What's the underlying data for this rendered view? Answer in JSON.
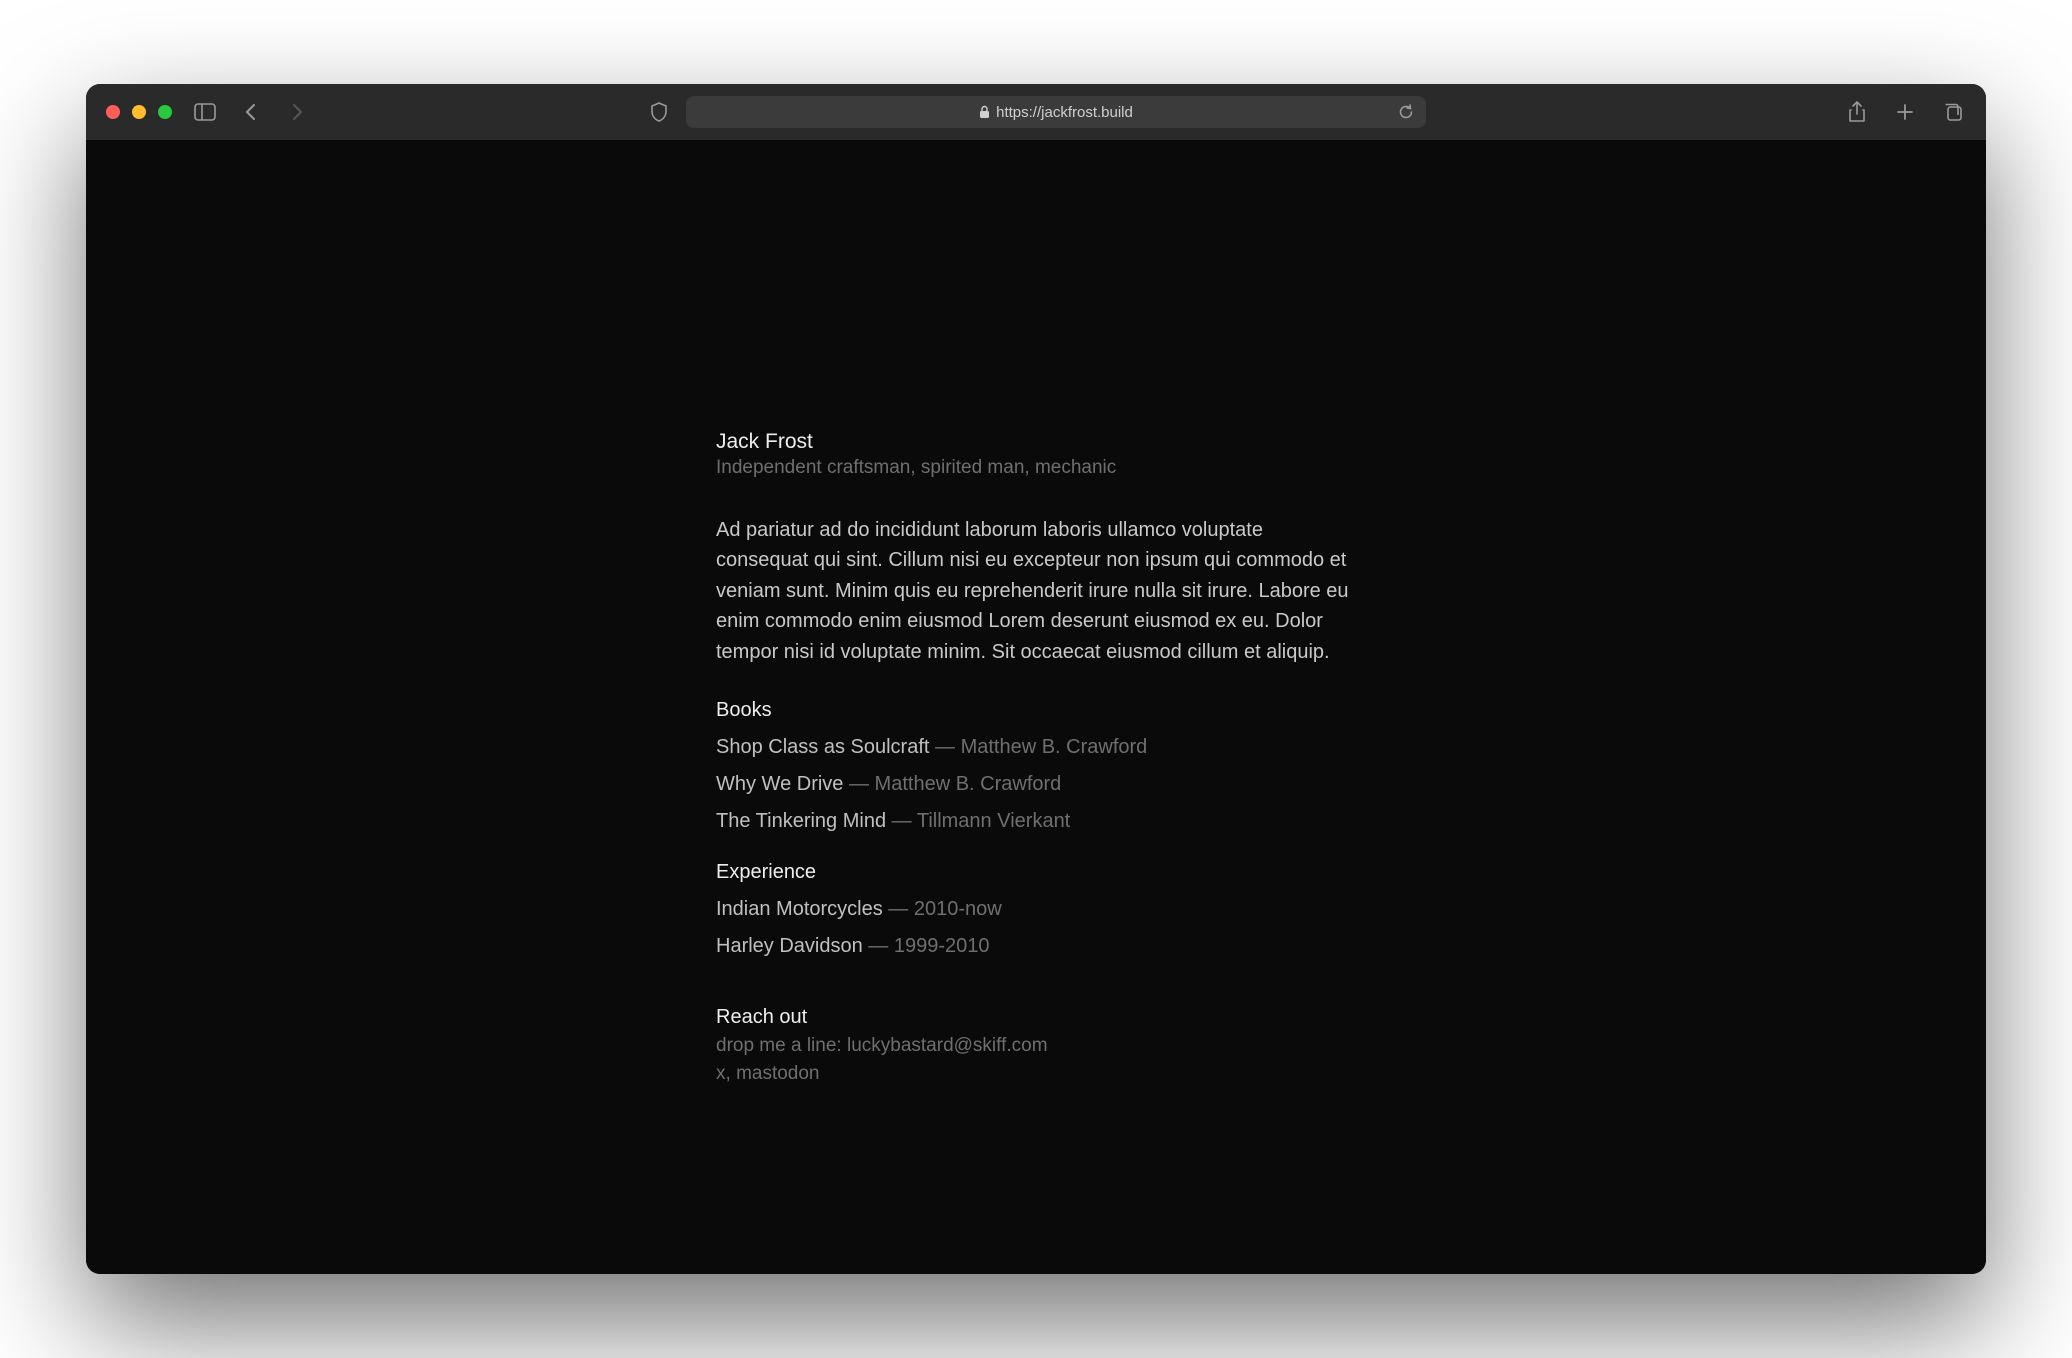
{
  "browser": {
    "url": "https://jackfrost.build"
  },
  "page": {
    "name": "Jack Frost",
    "tagline": "Independent craftsman, spirited man, mechanic",
    "bio": "Ad pariatur ad do incididunt laborum laboris ullamco voluptate consequat qui sint. Cillum nisi eu excepteur non ipsum qui commodo et veniam sunt. Minim quis eu reprehenderit irure nulla sit irure. Labore eu enim commodo enim eiusmod Lorem deserunt eiusmod ex eu. Dolor tempor nisi id voluptate minim. Sit occaecat eiusmod cillum et aliquip.",
    "books_heading": "Books",
    "books": [
      {
        "title": "Shop Class as Soulcraft",
        "author": "Matthew B. Crawford"
      },
      {
        "title": "Why We Drive",
        "author": "Matthew B. Crawford"
      },
      {
        "title": "The Tinkering Mind",
        "author": "Tillmann Vierkant"
      }
    ],
    "experience_heading": "Experience",
    "experience": [
      {
        "org": "Indian Motorcycles",
        "period": "2010-now"
      },
      {
        "org": "Harley Davidson",
        "period": "1999-2010"
      }
    ],
    "reach_heading": "Reach out",
    "reach_line1_prefix": "drop me a line: ",
    "reach_email": "luckybastard@skiff.com",
    "reach_links": [
      {
        "label": "x"
      },
      {
        "label": "mastodon"
      }
    ],
    "reach_sep": ", "
  }
}
